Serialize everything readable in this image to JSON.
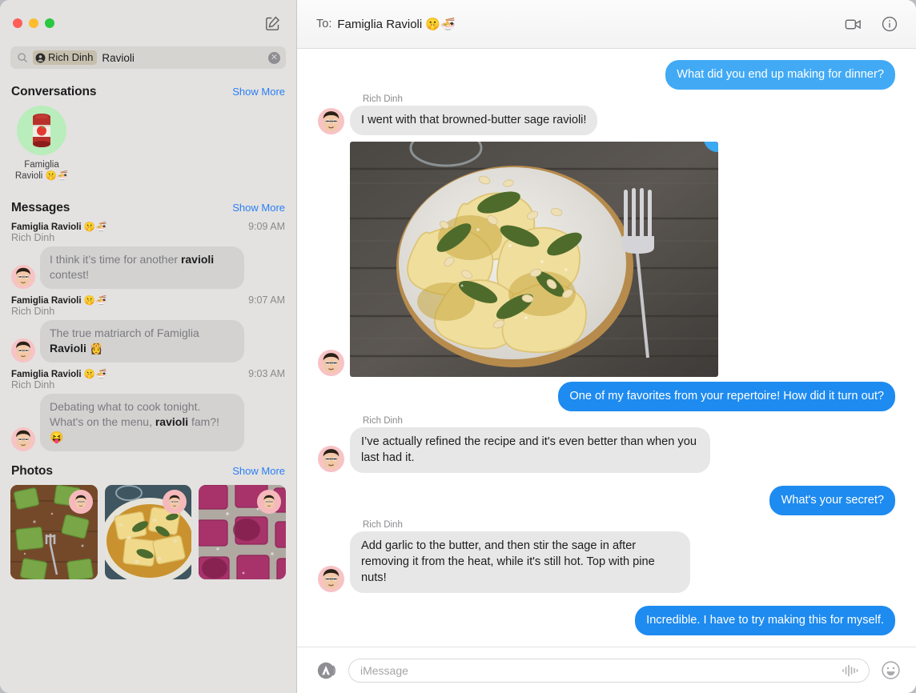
{
  "window": {
    "traffic_lights": [
      "close",
      "minimize",
      "zoom"
    ],
    "compose_icon": "compose-icon"
  },
  "search": {
    "glyph": "search-icon",
    "token_label": "Rich Dinh",
    "token_icon": "person-circle-icon",
    "query_text": "Ravioli",
    "clear_icon": "clear-icon",
    "clear_glyph": "✕"
  },
  "sidebar": {
    "sections": [
      {
        "title": "Conversations",
        "action": "Show More"
      },
      {
        "title": "Messages",
        "action": "Show More"
      },
      {
        "title": "Photos",
        "action": "Show More"
      }
    ],
    "conversations": [
      {
        "name_line1": "Famiglia",
        "name_line2": "Ravioli 🤫🍜",
        "avatar_emoji": "🥫",
        "avatar_bg": "#b9edbb"
      }
    ],
    "message_results": [
      {
        "group": "Famiglia Ravioli 🤫🍜",
        "sender": "Rich Dinh",
        "time": "9:09 AM",
        "text_before": "I think it’s time for another ",
        "highlight": "ravioli",
        "text_after": " contest!"
      },
      {
        "group": "Famiglia Ravioli 🤫🍜",
        "sender": "Rich Dinh",
        "time": "9:07 AM",
        "text_before": "The true matriarch of Famiglia ",
        "highlight": "Ravioli",
        "text_after": " 👸"
      },
      {
        "group": "Famiglia Ravioli 🤫🍜",
        "sender": "Rich Dinh",
        "time": "9:03 AM",
        "text_before": "Debating what to cook tonight. What's on the menu, ",
        "highlight": "ravioli",
        "text_after": " fam?! 😝"
      }
    ],
    "photos": [
      {
        "alt": "green spinach ravioli on wood board with fork"
      },
      {
        "alt": "yellow ravioli with sage and pine nuts on plate"
      },
      {
        "alt": "pink beet ravioli dusted with flour"
      }
    ]
  },
  "chat": {
    "to_label": "To:",
    "recipient": "Famiglia Ravioli 🤫🍜",
    "facetime_icon": "video-camera-icon",
    "info_icon": "info-circle-icon",
    "messages": [
      {
        "type": "text",
        "side": "out",
        "style": "light",
        "text": "What did you end up making for dinner?"
      },
      {
        "type": "text",
        "side": "in",
        "sender": "Rich Dinh",
        "text": "I went with that browned-butter sage ravioli!"
      },
      {
        "type": "image",
        "side": "in",
        "alt": "plate of browned-butter sage ravioli with pine nuts on rustic wood table with fork",
        "tapback": "heart",
        "tapback_color": "#3aa9f2",
        "heart_color": "#fc5e8c"
      },
      {
        "type": "text",
        "side": "out",
        "text": "One of my favorites from your repertoire! How did it turn out?"
      },
      {
        "type": "text",
        "side": "in",
        "sender": "Rich Dinh",
        "text": "I’ve actually refined the recipe and it's even better than when you last had it."
      },
      {
        "type": "text",
        "side": "out",
        "text": "What's your secret?"
      },
      {
        "type": "text",
        "side": "in",
        "sender": "Rich Dinh",
        "text": "Add garlic to the butter, and then stir the sage in after removing it from the heat, while it's still hot. Top with pine nuts!"
      },
      {
        "type": "text",
        "side": "out",
        "text": "Incredible. I have to try making this for myself."
      }
    ]
  },
  "composer": {
    "apps_icon": "app-store-icon",
    "placeholder": "iMessage",
    "value": "",
    "audio_icon": "audio-waveform-icon",
    "emoji_icon": "emoji-smiley-icon",
    "emoji_glyph": "☺"
  },
  "colors": {
    "accent_blue": "#1e8bf0",
    "accent_blue_light": "#42aaf5",
    "link_blue": "#2b7ef5",
    "bubble_gray": "#e7e7e8",
    "sidebar_bg": "#e3e2e0",
    "token_bg": "#c6bfad"
  }
}
